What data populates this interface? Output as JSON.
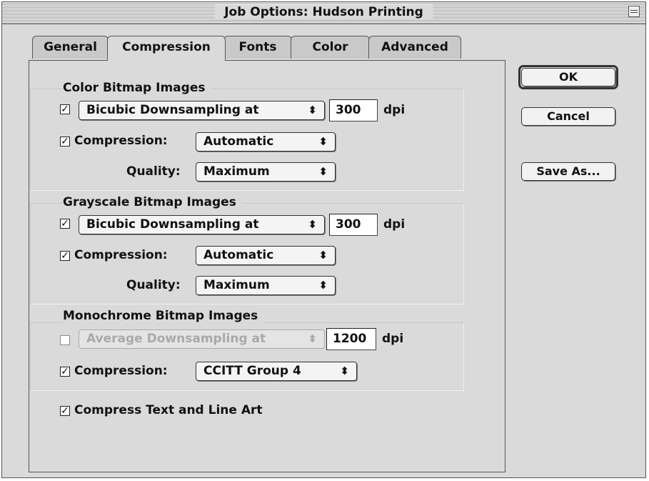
{
  "window": {
    "title": "Job Options: Hudson Printing"
  },
  "tabs": [
    {
      "label": "General"
    },
    {
      "label": "Compression"
    },
    {
      "label": "Fonts"
    },
    {
      "label": "Color"
    },
    {
      "label": "Advanced"
    }
  ],
  "active_tab": "Compression",
  "color": {
    "title": "Color Bitmap Images",
    "downsample_checked": true,
    "downsample_method": "Bicubic Downsampling at",
    "dpi_value": "300",
    "dpi_unit": "dpi",
    "compression_checked": true,
    "compression_label": "Compression:",
    "compression_value": "Automatic",
    "quality_label": "Quality:",
    "quality_value": "Maximum"
  },
  "grayscale": {
    "title": "Grayscale Bitmap Images",
    "downsample_checked": true,
    "downsample_method": "Bicubic Downsampling at",
    "dpi_value": "300",
    "dpi_unit": "dpi",
    "compression_checked": true,
    "compression_label": "Compression:",
    "compression_value": "Automatic",
    "quality_label": "Quality:",
    "quality_value": "Maximum"
  },
  "monochrome": {
    "title": "Monochrome Bitmap Images",
    "downsample_checked": false,
    "downsample_method": "Average Downsampling at",
    "dpi_value": "1200",
    "dpi_unit": "dpi",
    "compression_checked": true,
    "compression_label": "Compression:",
    "compression_value": "CCITT Group 4"
  },
  "compress_text": {
    "checked": true,
    "label": "Compress Text and Line Art"
  },
  "buttons": {
    "ok": "OK",
    "cancel": "Cancel",
    "save_as": "Save As..."
  },
  "glyphs": {
    "check": "✓",
    "popup_arrows": "⬍"
  }
}
